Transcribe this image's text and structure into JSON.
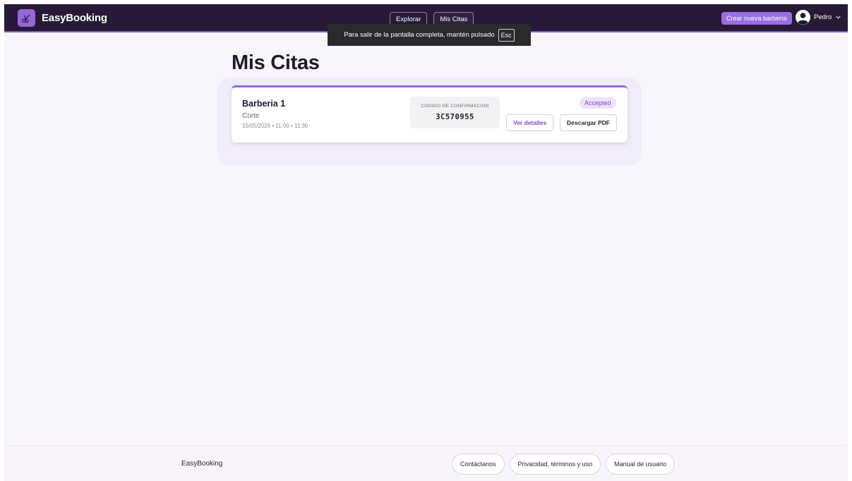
{
  "header": {
    "brand": "EasyBooking",
    "nav": [
      {
        "label": "Explorar"
      },
      {
        "label": "Mis Citas"
      }
    ],
    "create_button": "Crear nueva barbería",
    "user_name": "Pedro"
  },
  "fullscreen_notice": {
    "text": "Para salir de la pantalla completa, mantén pulsado",
    "key": "Esc"
  },
  "main": {
    "title": "Mis Citas",
    "appointments": [
      {
        "shop": "Barberia 1",
        "service": "Corte",
        "datetime": "15/05/2026 • 11:00 • 11:30",
        "code_label": "CODIGO DE CONFIRMACION",
        "code": "3C570955",
        "status": "Accepted",
        "details_button": "Ver detalles",
        "pdf_button": "Descargar PDF"
      }
    ]
  },
  "footer": {
    "brand": "EasyBooking",
    "links": [
      {
        "label": "Contáctanos"
      },
      {
        "label": "Privacidad, términos y uso"
      },
      {
        "label": "Manual de usuario"
      }
    ]
  },
  "colors": {
    "header_bg": "#261a36",
    "accent": "#9667da",
    "status_bg": "#ece3fb",
    "status_text": "#7a45cf"
  },
  "icons": {
    "brand": "scissors-icon",
    "avatar": "user-avatar-icon",
    "user_menu": "chevron-down-icon"
  }
}
